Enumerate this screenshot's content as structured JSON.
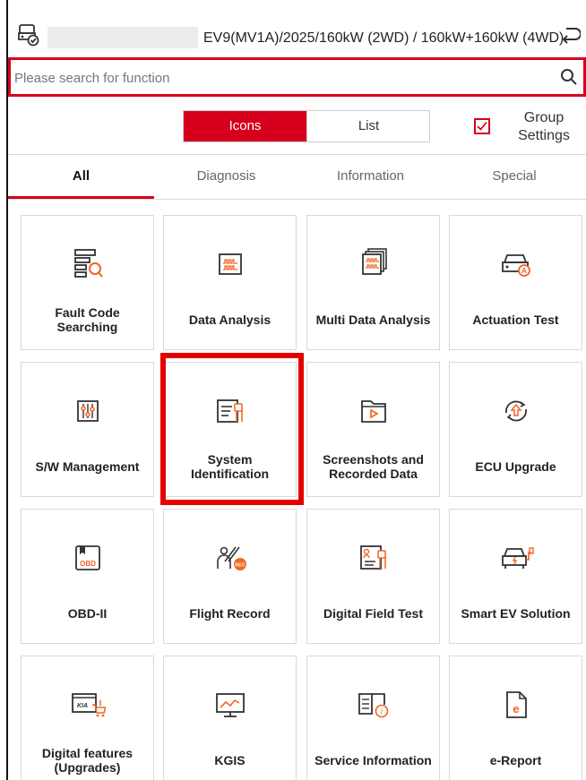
{
  "header": {
    "vehicle": "EV9(MV1A)/2025/160kW (2WD) / 160kW+160kW (4WD)",
    "car_icon": "car-check-icon",
    "back_icon": "return-arrow-icon"
  },
  "search": {
    "placeholder": "Please search for function",
    "icon": "search-icon"
  },
  "view_toggle": {
    "icons": "Icons",
    "list": "List",
    "selected": "Icons"
  },
  "group_settings": {
    "label": "Group Settings",
    "checked": true
  },
  "tabs": [
    "All",
    "Diagnosis",
    "Information",
    "Special"
  ],
  "active_tab": "All",
  "tiles": [
    {
      "label": "Fault Code Searching",
      "icon": "fault-code-search-icon"
    },
    {
      "label": "Data Analysis",
      "icon": "data-analysis-icon"
    },
    {
      "label": "Multi Data Analysis",
      "icon": "multi-data-analysis-icon"
    },
    {
      "label": "Actuation Test",
      "icon": "actuation-test-icon"
    },
    {
      "label": "S/W Management",
      "icon": "sw-management-icon"
    },
    {
      "label": "System Identification",
      "icon": "system-identification-icon"
    },
    {
      "label": "Screenshots and Recorded Data",
      "icon": "screenshots-folder-icon"
    },
    {
      "label": "ECU Upgrade",
      "icon": "ecu-upgrade-icon"
    },
    {
      "label": "OBD-II",
      "icon": "obd-icon",
      "icon_text": "OBD"
    },
    {
      "label": "Flight Record",
      "icon": "flight-record-icon",
      "icon_text": "REC"
    },
    {
      "label": "Digital Field Test",
      "icon": "digital-field-test-icon"
    },
    {
      "label": "Smart EV Solution",
      "icon": "smart-ev-icon"
    },
    {
      "label": "Digital features (Upgrades)",
      "icon": "digital-features-cart-icon"
    },
    {
      "label": "KGIS",
      "icon": "kgis-monitor-icon"
    },
    {
      "label": "Service Information",
      "icon": "service-info-book-icon"
    },
    {
      "label": "e-Report",
      "icon": "e-report-icon",
      "icon_text": "e"
    }
  ],
  "colors": {
    "accent": "#d6001c",
    "icon_accent": "#f26522",
    "highlight": "#e50000"
  }
}
